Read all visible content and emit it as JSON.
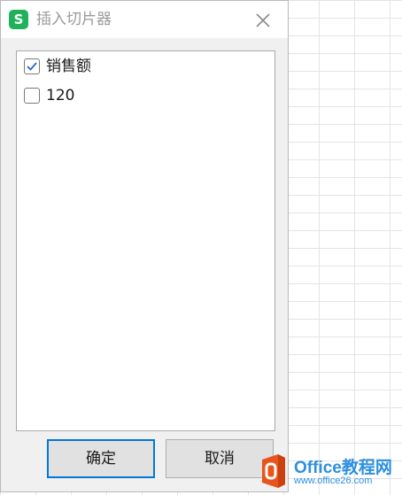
{
  "dialog": {
    "title": "插入切片器",
    "app_icon_letter": "S",
    "app_icon_color": "#1fb25a",
    "close_icon": "close-icon"
  },
  "list": {
    "items": [
      {
        "label": "销售额",
        "checked": true
      },
      {
        "label": "120",
        "checked": false
      }
    ]
  },
  "buttons": {
    "ok_label": "确定",
    "cancel_label": "取消"
  },
  "watermark": {
    "brand": "Office教程网",
    "url": "www.office26.com",
    "accent_color": "#2d8fe0",
    "logo_color": "#e8541c"
  }
}
